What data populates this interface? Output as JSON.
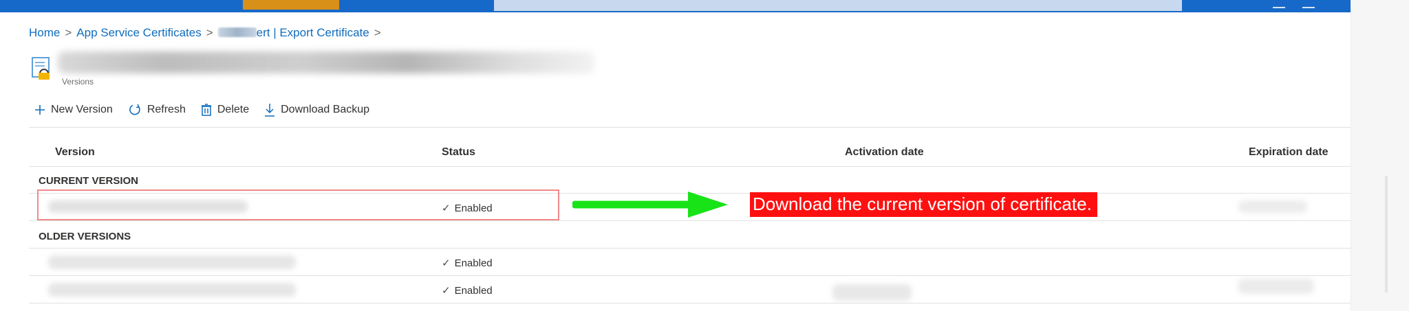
{
  "breadcrumb": {
    "home": "Home",
    "certificates": "App Service Certificates",
    "current_suffix": "ert | Export Certificate"
  },
  "header": {
    "subtitle": "Versions"
  },
  "toolbar": {
    "new_version": "New Version",
    "refresh": "Refresh",
    "delete": "Delete",
    "download_backup": "Download Backup"
  },
  "table": {
    "columns": {
      "version": "Version",
      "status": "Status",
      "activation_date": "Activation date",
      "expiration_date": "Expiration date"
    },
    "groups": {
      "current": "CURRENT VERSION",
      "older": "OLDER VERSIONS"
    },
    "rows": [
      {
        "status": "Enabled"
      },
      {
        "status": "Enabled"
      },
      {
        "status": "Enabled"
      }
    ]
  },
  "annotation": {
    "callout_text": "Download the current version of certificate.",
    "callout_color": "#ff1010",
    "arrow_color": "#17e317",
    "highlight_color": "#f08a8a"
  },
  "icons": {
    "certificate": "certificate-icon",
    "add": "plus-icon",
    "refresh": "refresh-icon",
    "delete": "trash-icon",
    "download": "download-icon",
    "check": "checkmark-icon"
  },
  "colors": {
    "link": "#0f6cbd",
    "topbar": "#1769c9",
    "text": "#323130"
  }
}
